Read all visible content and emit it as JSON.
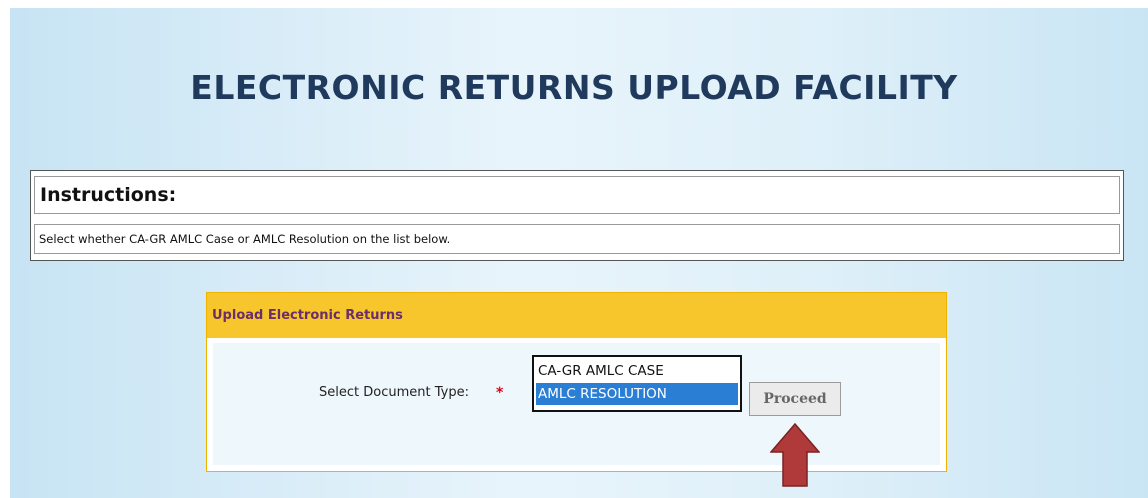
{
  "page": {
    "title": "ELECTRONIC RETURNS UPLOAD FACILITY"
  },
  "instructions": {
    "heading": "Instructions:",
    "text": "Select whether CA-GR AMLC Case or AMLC Resolution on the list below."
  },
  "upload_panel": {
    "heading": "Upload Electronic Returns",
    "document_type_label": "Select Document Type:",
    "required_marker": "*",
    "document_type_options": [
      "CA-GR AMLC CASE",
      "AMLC RESOLUTION"
    ],
    "selected_option": "AMLC RESOLUTION",
    "proceed_label": "Proceed"
  },
  "colors": {
    "title": "#1f3a5c",
    "panel_header": "#f7c62c",
    "panel_header_text": "#6b2d6b",
    "selected_option_bg": "#2a7fd5",
    "arrow": "#b03a3a"
  },
  "icons": {
    "annotation": "up-arrow-icon"
  }
}
